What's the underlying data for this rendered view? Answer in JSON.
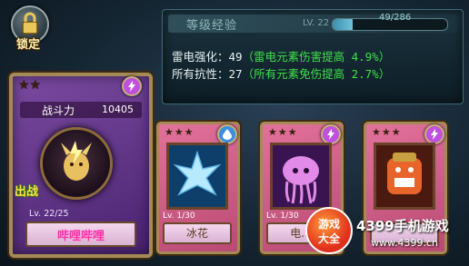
{
  "lock": {
    "label": "锁定"
  },
  "exp": {
    "title": "等级经验",
    "lv_label": "LV. 22",
    "count": "49/286",
    "progress": 0.171
  },
  "stats": [
    {
      "label": "雷电强化：49",
      "bonus": "（雷电元素伤害提高 4.9%）"
    },
    {
      "label": "所有抗性：27",
      "bonus": "（所有元素免伤提高 2.7%）"
    }
  ],
  "main_card": {
    "stars": "★★",
    "power_label": "战斗力",
    "power_value": "10405",
    "deploy_label": "出战",
    "level": "Lv. 22/25",
    "name": "哔哩哔哩",
    "element_icon": "lightning-icon",
    "element_color": "#c050e0"
  },
  "cards": [
    {
      "stars": "★★★",
      "level": "Lv. 1/30",
      "name": "冰花",
      "element_icon": "water-drop-icon",
      "element_color": "#3a8fe0"
    },
    {
      "stars": "★★★",
      "level": "Lv. 1/30",
      "name": "电...",
      "element_icon": "lightning-icon",
      "element_color": "#c050e0"
    },
    {
      "stars": "★★★",
      "level": "",
      "name": "",
      "element_icon": "lightning-icon",
      "element_color": "#c050e0"
    }
  ],
  "watermark": {
    "logo_line1": "游戏",
    "logo_line2": "大全",
    "site_name": "4399手机游戏",
    "url": "www.4399.cn"
  }
}
